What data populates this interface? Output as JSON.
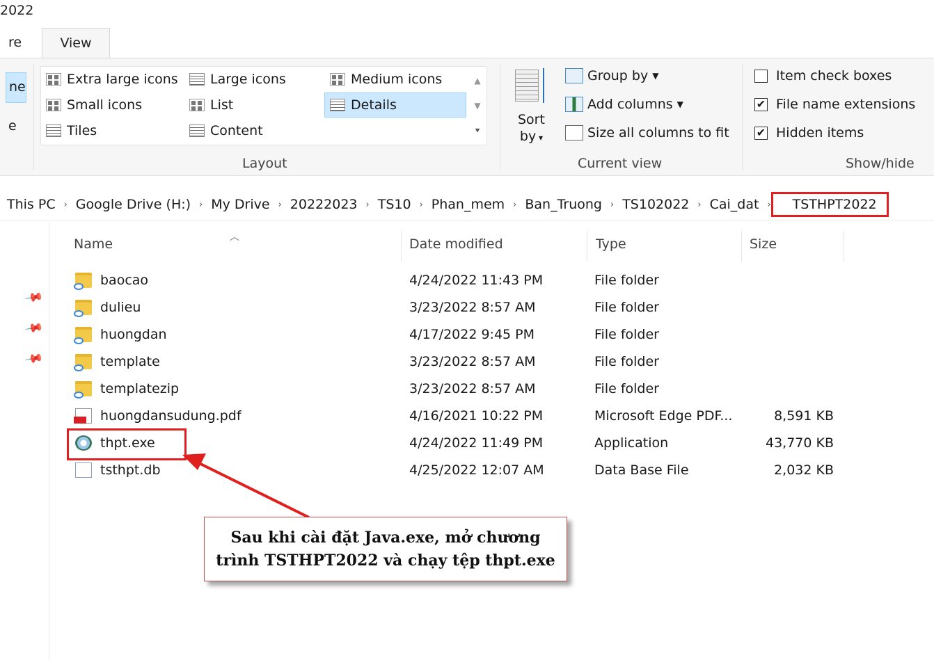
{
  "window": {
    "title_fragment": "2022"
  },
  "ribbon": {
    "tab_share_fragment": "re",
    "tab_view": "View",
    "pane_fragment_top": "ne",
    "pane_fragment_bottom": "e",
    "layout": {
      "items": [
        "Extra large icons",
        "Large icons",
        "Medium icons",
        "Small icons",
        "List",
        "Details",
        "Tiles",
        "Content"
      ],
      "selected": "Details",
      "label": "Layout"
    },
    "sort": {
      "line1": "Sort",
      "line2": "by"
    },
    "current_view": {
      "group_by": "Group by",
      "add_columns": "Add columns",
      "size_all": "Size all columns to fit",
      "label": "Current view"
    },
    "show_hide": {
      "item_check_boxes": {
        "label": "Item check boxes",
        "checked": false
      },
      "file_name_extensions": {
        "label": "File name extensions",
        "checked": true
      },
      "hidden_items": {
        "label": "Hidden items",
        "checked": true
      },
      "label": "Show/hide"
    }
  },
  "breadcrumb": [
    "This PC",
    "Google Drive (H:)",
    "My Drive",
    "20222023",
    "TS10",
    "Phan_mem",
    "Ban_Truong",
    "TS102022",
    "Cai_dat",
    "TSTHPT2022"
  ],
  "columns": {
    "name": "Name",
    "date": "Date modified",
    "type": "Type",
    "size": "Size"
  },
  "files": [
    {
      "name": "baocao",
      "date": "4/24/2022 11:43 PM",
      "type": "File folder",
      "size": "",
      "icon": "folder-icon"
    },
    {
      "name": "dulieu",
      "date": "3/23/2022 8:57 AM",
      "type": "File folder",
      "size": "",
      "icon": "folder-icon"
    },
    {
      "name": "huongdan",
      "date": "4/17/2022 9:45 PM",
      "type": "File folder",
      "size": "",
      "icon": "folder-icon"
    },
    {
      "name": "template",
      "date": "3/23/2022 8:57 AM",
      "type": "File folder",
      "size": "",
      "icon": "folder-icon"
    },
    {
      "name": "templatezip",
      "date": "3/23/2022 8:57 AM",
      "type": "File folder",
      "size": "",
      "icon": "folder-icon"
    },
    {
      "name": "huongdansudung.pdf",
      "date": "4/16/2021 10:22 PM",
      "type": "Microsoft Edge PDF...",
      "size": "8,591 KB",
      "icon": "pdf-icon"
    },
    {
      "name": "thpt.exe",
      "date": "4/24/2022 11:49 PM",
      "type": "Application",
      "size": "43,770 KB",
      "icon": "exe-icon"
    },
    {
      "name": "tsthpt.db",
      "date": "4/25/2022 12:07 AM",
      "type": "Data Base File",
      "size": "2,032 KB",
      "icon": "db-icon"
    }
  ],
  "callout": {
    "line1": "Sau khi cài đặt Java.exe, mở chương",
    "line2": "trình TSTHPT2022 và chạy tệp thpt.exe"
  },
  "colors": {
    "highlight_red": "#e02020",
    "selection_blue": "#cce8ff",
    "arrow_red": "#e0201f"
  }
}
